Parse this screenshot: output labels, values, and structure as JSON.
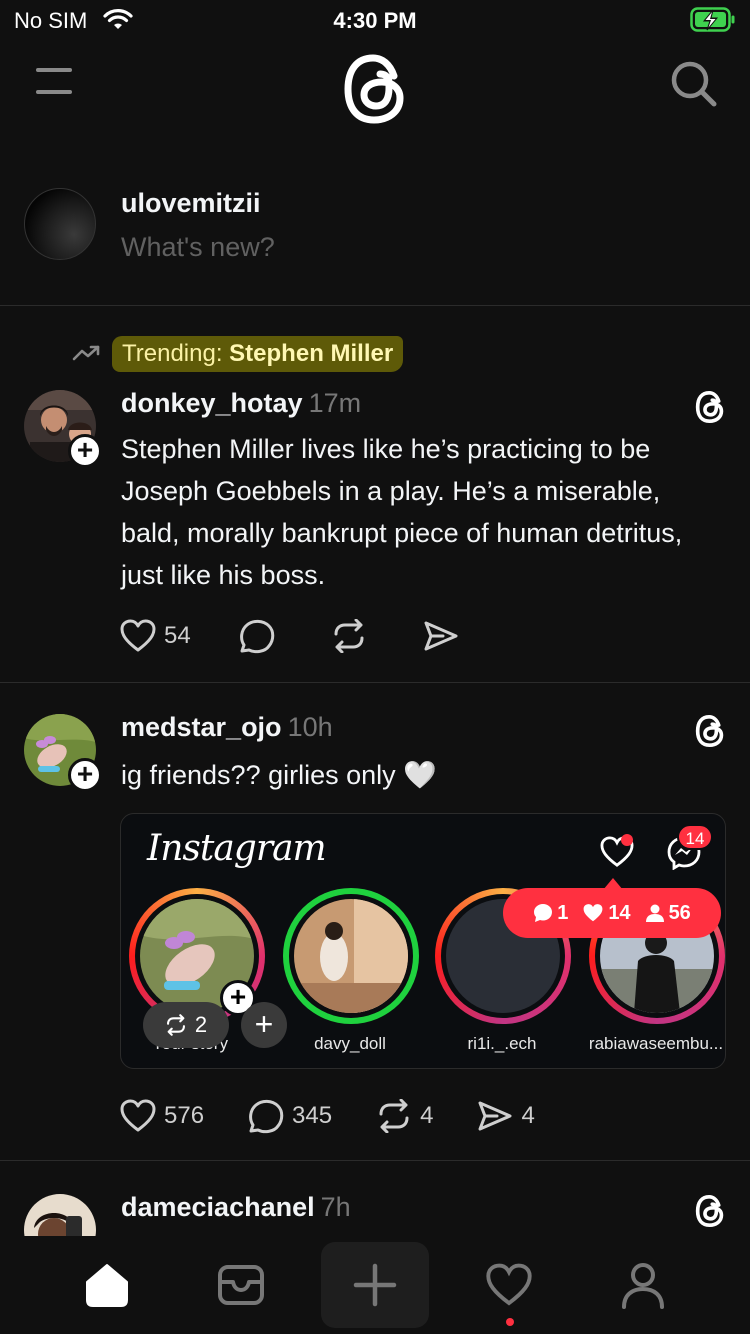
{
  "status_bar": {
    "carrier": "No SIM",
    "time": "4:30 PM"
  },
  "header": {
    "menu_icon": "menu-icon",
    "logo_icon": "threads-logo-icon",
    "search_icon": "search-icon"
  },
  "compose": {
    "username": "ulovemitzii",
    "placeholder": "What's new?"
  },
  "trending": {
    "prefix": "Trending:",
    "topic": "Stephen Miller",
    "icon": "trending-up-icon"
  },
  "posts": [
    {
      "username": "donkey_hotay",
      "time": "17m",
      "text": "Stephen Miller lives like he’s practicing to be Joseph Goebbels in a play. He’s a miserable, bald, morally bankrupt piece of human detritus, just like his boss.",
      "likes": "54",
      "replies": "",
      "reposts": "",
      "shares": ""
    },
    {
      "username": "medstar_ojo",
      "time": "10h",
      "text": "ig friends?? girlies only 🤍",
      "likes": "576",
      "replies": "345",
      "reposts": "4",
      "shares": "4",
      "embed": {
        "wordmark": "Instagram",
        "dm_badge": "14",
        "notifications": {
          "comments": "1",
          "likes": "14",
          "follows": "56"
        },
        "stories": [
          {
            "label": "Your story"
          },
          {
            "label": "davy_doll"
          },
          {
            "label": "ri1i._.ech"
          },
          {
            "label": "rabiawaseembu..."
          }
        ],
        "repost_count": "2",
        "add_label": "+"
      }
    },
    {
      "username": "dameciachanel",
      "time": "7h"
    }
  ],
  "tab_bar": [
    "home-icon",
    "inbox-icon",
    "new-thread-icon",
    "activity-icon",
    "profile-icon"
  ],
  "colors": {
    "background": "#101010",
    "accent": "#ff3040",
    "highlight": "#5e5a08",
    "muted": "#777777"
  }
}
